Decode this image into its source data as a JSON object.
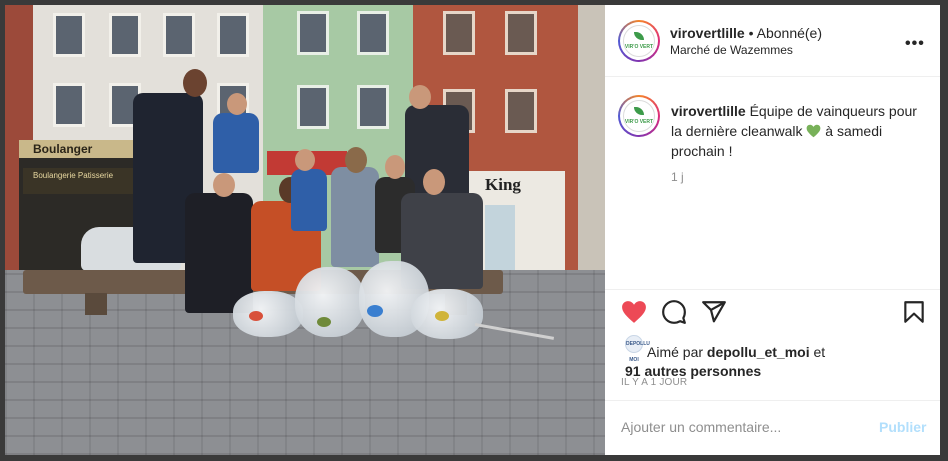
{
  "post": {
    "username": "virovertlille",
    "separator": " • ",
    "follow_status": "Abonné(e)",
    "location": "Marché de Wazemmes",
    "more_label": "•••",
    "avatar_text": "VIR'O VERT",
    "caption_username": "virovertlille",
    "caption_text": " Équipe de vainqueurs pour la dernière cleanwalk ",
    "caption_suffix": " à samedi prochain !",
    "caption_emoji": "green-heart-icon",
    "caption_age": "1 j",
    "liked_by_prefix": "Aimé par ",
    "liked_by_user": "depollu_et_moi",
    "liked_by_and": " et",
    "liked_by_others": "91 autres personnes",
    "liker_avatar_text": "DEPOLLU MOI",
    "time_ago": "IL Y A 1 JOUR",
    "comment_placeholder": "Ajouter un commentaire...",
    "publish_label": "Publier"
  },
  "photo": {
    "shop_sign_1": "Boulanger",
    "shop_sign_2": "Boulangerie Patisserie",
    "shop_sign_3": "King"
  },
  "colors": {
    "like_red": "#ed4956",
    "publish_disabled": "#b2dffc",
    "emoji_green": "#78b159"
  },
  "icons": [
    "heart-icon",
    "comment-icon",
    "share-icon",
    "bookmark-icon",
    "more-icon"
  ]
}
